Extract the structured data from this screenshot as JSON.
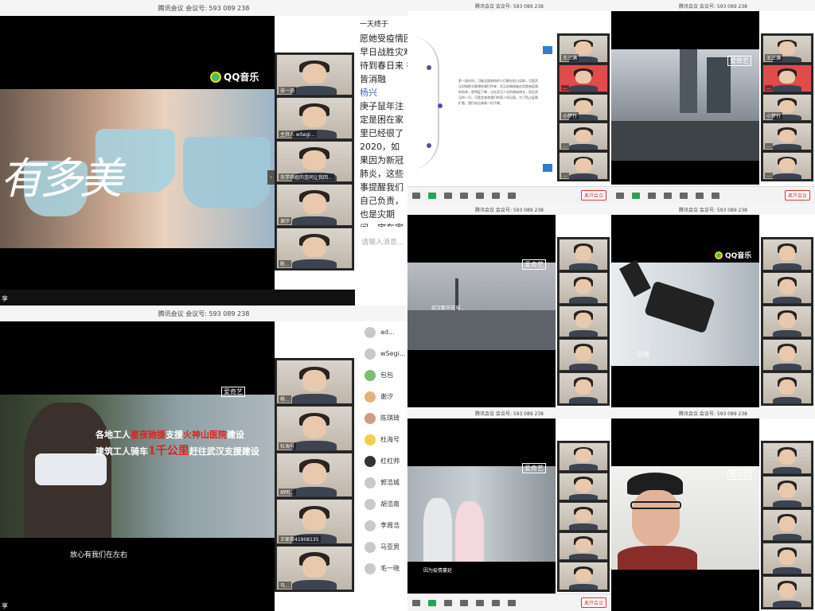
{
  "meeting": {
    "title": "腾讯会议 会议号: 593 089 238",
    "end_label": "离开会议"
  },
  "panel1": {
    "video": {
      "brand": "QQ音乐",
      "big_text": "有多美"
    },
    "thumbs": [
      {
        "name": "张一涵"
      },
      {
        "name": "主持人 wSegi..."
      },
      {
        "name": "东学琪姐的连同让我回..."
      },
      {
        "name": "谢汐"
      },
      {
        "name": "陈..."
      }
    ],
    "chat": {
      "lines": [
        "一天终于",
        "愿她受疫情困扰",
        "早日战胜灾难",
        "待到春日来 神州",
        "皆消融"
      ],
      "sender": "杨兴",
      "message": "庚子鼠年注定是困在家里已经很了2020，如果因为新冠肺炎，这些事提醒我们自己负责，也是灾期间，宅在家口罩，等疫情过夜，注意饮食，成良好的生活习惯来。",
      "input_placeholder": "请输入消息..."
    },
    "share_label": "享"
  },
  "panel2": {
    "slide_text": "那一段时间，可能全国各地的人们都在担心局势，可是武汉封城那天都想给我们传来：武汉封城措施必定换来疫情的结束，是将疫下降，当在武汉人员的感染增长，而在武汉的一月，可是会来和我们的家人所见面，为了防止疫情扩散，我们站出来做一份子做。",
    "thumbs": [
      {
        "name": "王三满"
      },
      {
        "name": "..."
      },
      {
        "name": "小梦竹"
      },
      {
        "name": "..."
      },
      {
        "name": "..."
      }
    ]
  },
  "panel3": {
    "thumbs": [
      {
        "name": "王三满"
      },
      {
        "name": "..."
      },
      {
        "name": "小梦竹"
      },
      {
        "name": "..."
      },
      {
        "name": "..."
      }
    ]
  },
  "panel4": {
    "brand": "爱奇艺",
    "caption": "武汉都市花城..."
  },
  "panel5": {
    "brand": "QQ音乐",
    "caption": "日夜"
  },
  "panel6": {
    "brand": "爱奇艺",
    "headline1": "各地工人",
    "headline1_red": "星夜驰援",
    "headline1_b": "支援",
    "headline1_red2": "火神山医院",
    "headline1_c": "建设",
    "headline2": "建筑工人骑车",
    "headline2_red": "1千公里",
    "headline2_b": "赶往武汉支援建设",
    "subtitle": "放心有我们在左右",
    "thumbs": [
      {
        "name": "杨..."
      },
      {
        "name": "杜海号"
      },
      {
        "name": "胡明..."
      },
      {
        "name": "王家豪41908135"
      },
      {
        "name": "马..."
      }
    ],
    "participants": [
      {
        "name": "ad..."
      },
      {
        "name": "wSegi..."
      },
      {
        "name": "包包"
      },
      {
        "name": "谢汐"
      },
      {
        "name": "陈琪琦"
      },
      {
        "name": "杜海号"
      },
      {
        "name": "杠杠帅"
      },
      {
        "name": "郭浩城"
      },
      {
        "name": "胡浩南"
      },
      {
        "name": "李周浩"
      },
      {
        "name": "马亚男"
      },
      {
        "name": "毛一晓"
      }
    ],
    "share_label": "享"
  },
  "panel7": {
    "brand": "爱奇艺",
    "caption": "因为疫情蔓延"
  },
  "panel8": {
    "brand": "爱奇艺"
  }
}
